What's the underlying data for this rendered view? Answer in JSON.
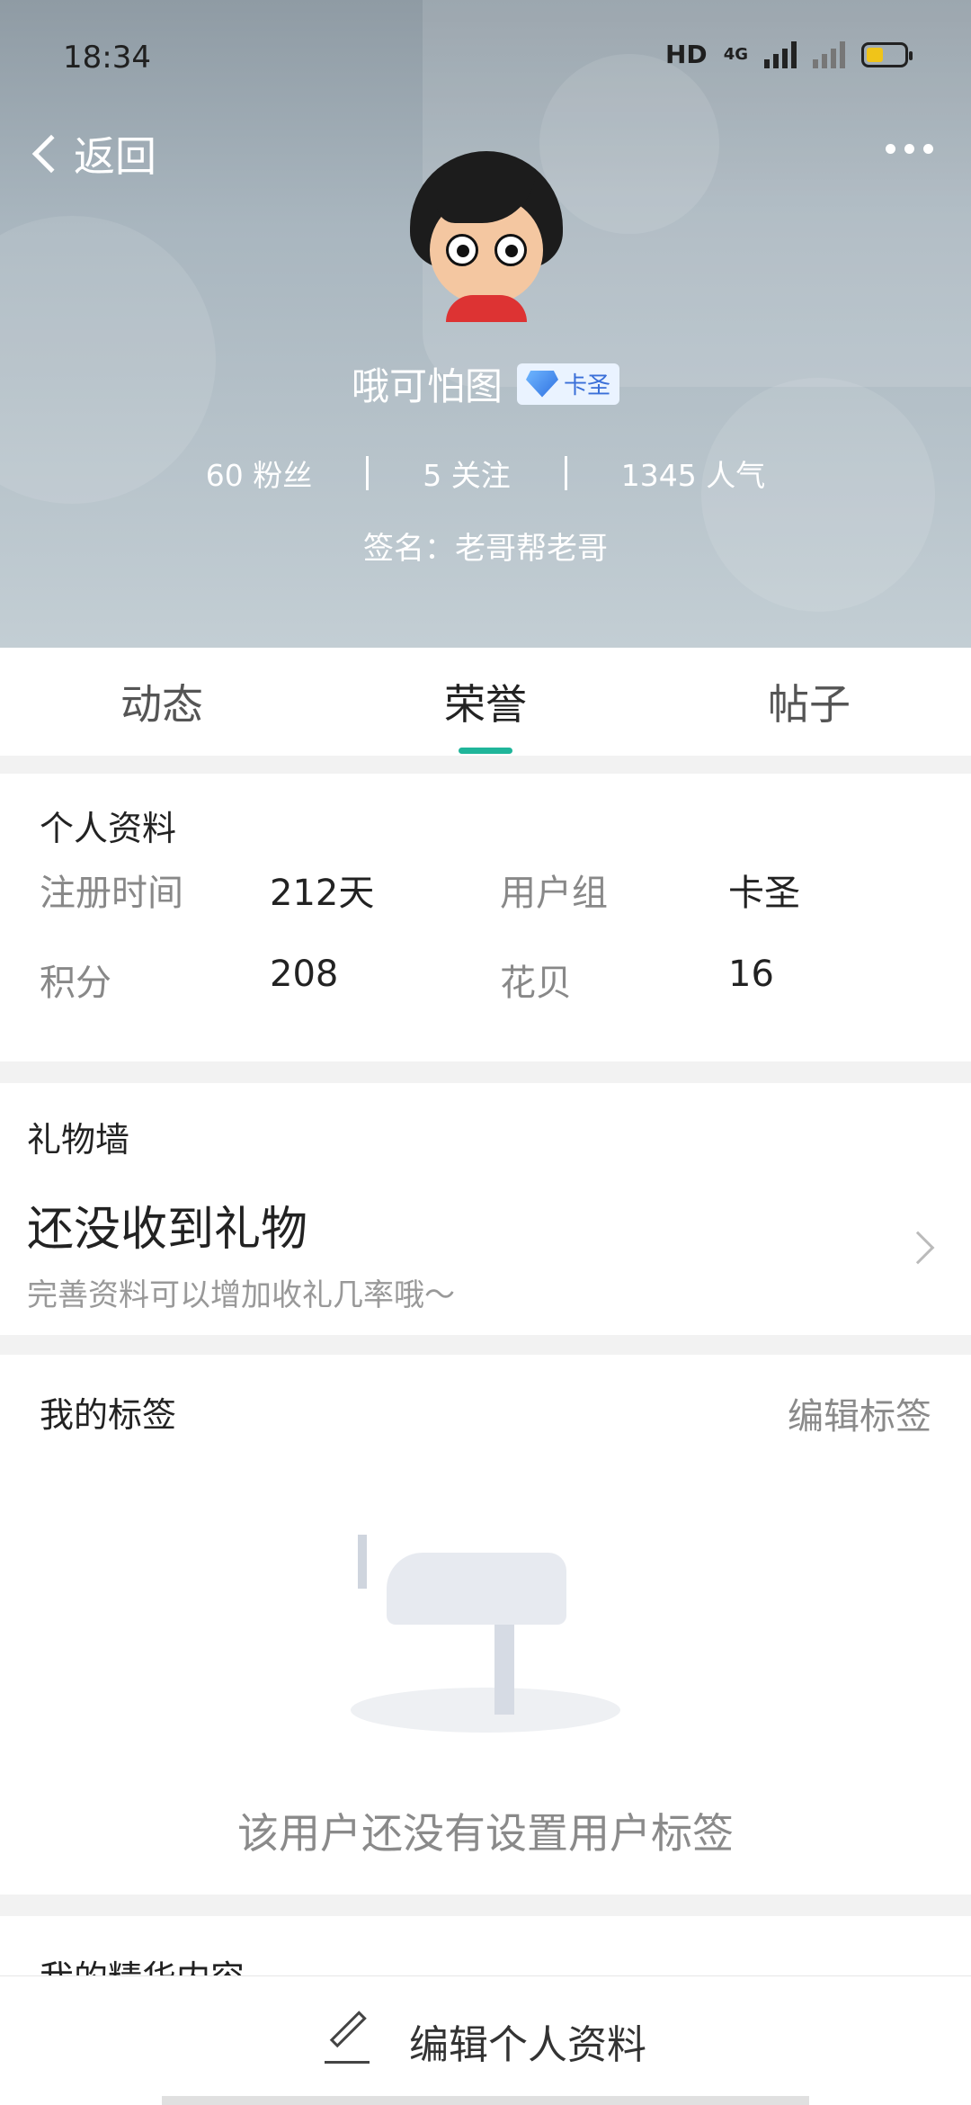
{
  "status": {
    "time": "18:34",
    "network_label": "HD",
    "network_type": "4G",
    "battery_percent": 45
  },
  "nav": {
    "back_label": "返回"
  },
  "user": {
    "name": "哦可怕图",
    "badge_label": "卡圣",
    "fans": "60 粉丝",
    "following": "5 关注",
    "popularity": "1345 人气",
    "signature": "签名：老哥帮老哥"
  },
  "tabs": [
    {
      "label": "动态"
    },
    {
      "label": "荣誉"
    },
    {
      "label": "帖子"
    }
  ],
  "active_tab": "荣誉",
  "profile": {
    "title": "个人资料",
    "fields": [
      {
        "label": "注册时间",
        "value": "212天"
      },
      {
        "label": "用户组",
        "value": "卡圣"
      },
      {
        "label": "积分",
        "value": "208"
      },
      {
        "label": "花贝",
        "value": "16"
      }
    ]
  },
  "gifts": {
    "title": "礼物墙",
    "headline": "还没收到礼物",
    "subtext": "完善资料可以增加收礼几率哦～"
  },
  "tags": {
    "title": "我的标签",
    "edit_label": "编辑标签",
    "empty_text": "该用户还没有设置用户标签"
  },
  "featured": {
    "title": "我的精华内容"
  },
  "bottom_action": {
    "label": "编辑个人资料"
  },
  "colors": {
    "accent": "#1fb59a",
    "badge_blue": "#3a6fd8"
  }
}
